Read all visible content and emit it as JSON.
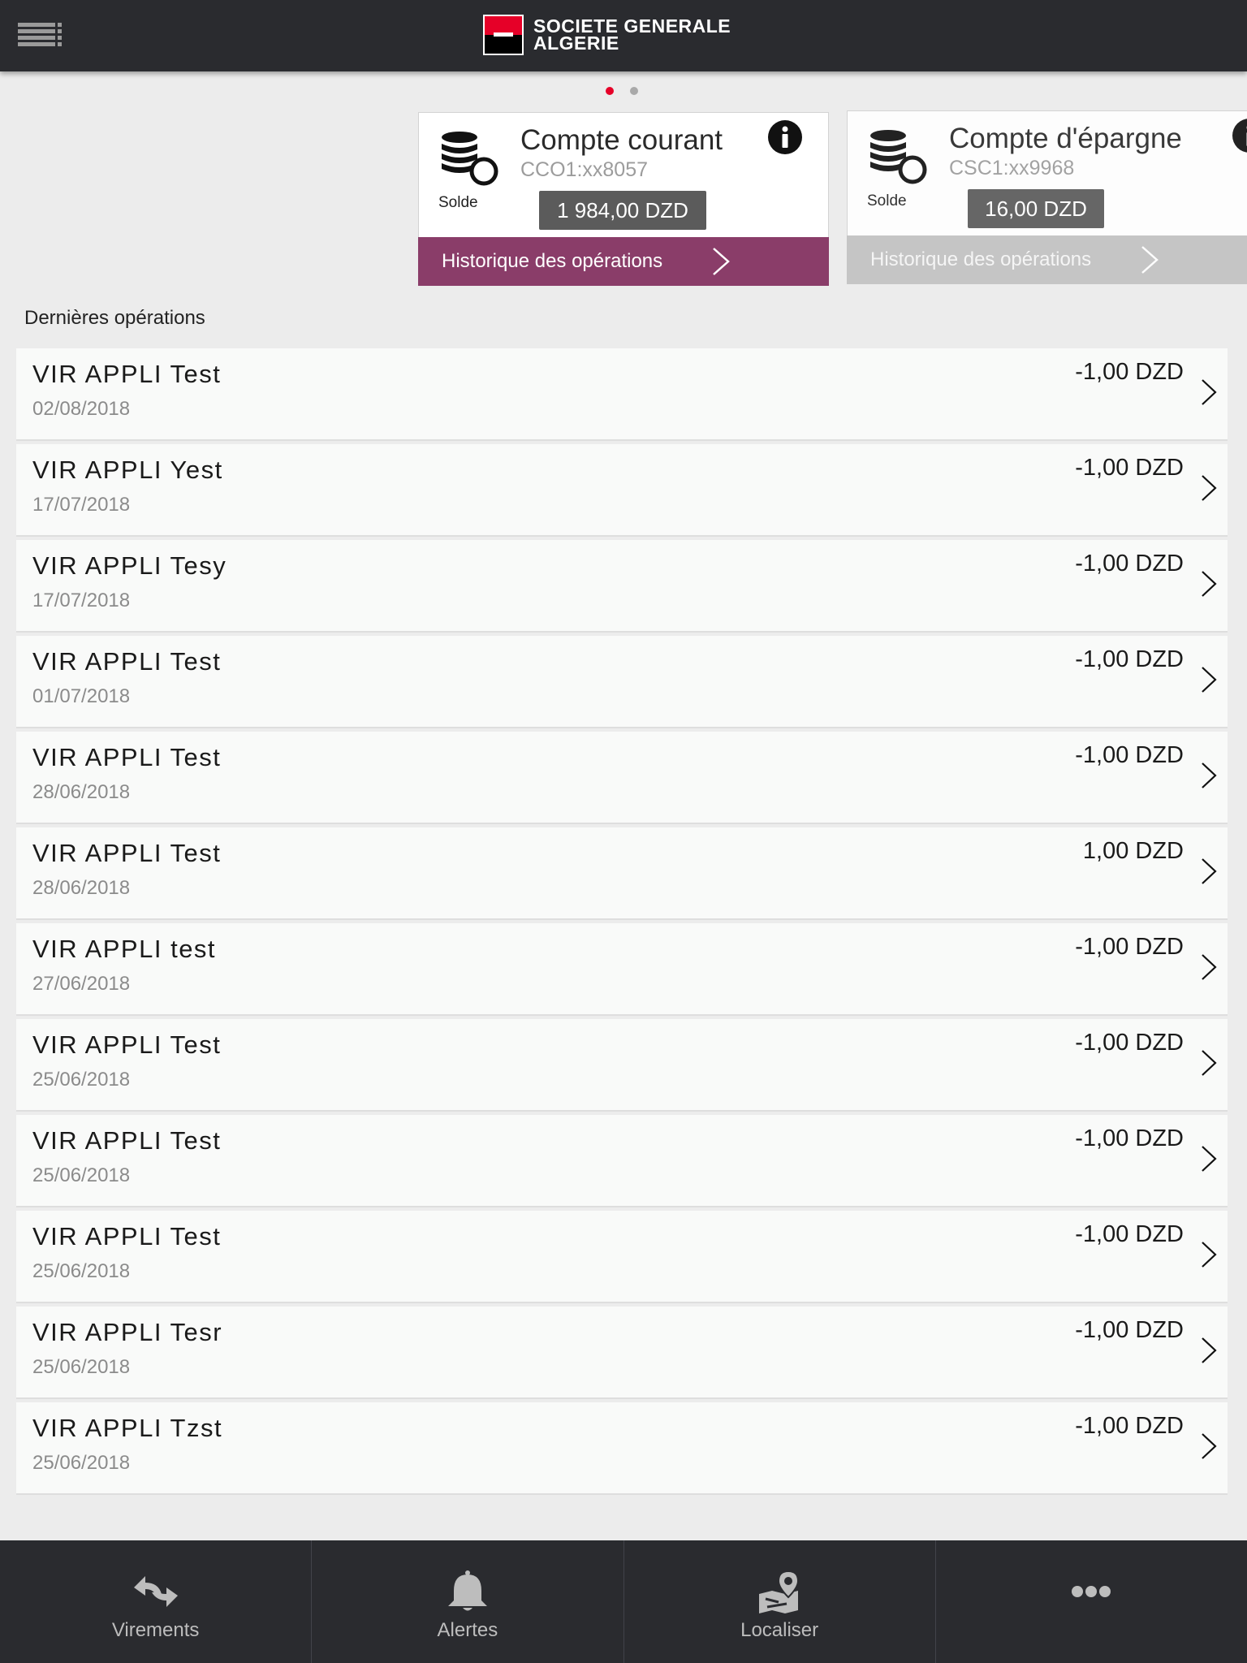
{
  "header": {
    "brand_line1": "SOCIETE GENERALE",
    "brand_line2": "ALGERIE",
    "menu_icon": "hamburger-menu-icon"
  },
  "pager": {
    "pages": 2,
    "active_index": 0
  },
  "accounts": [
    {
      "title": "Compte courant",
      "number": "CCO1:xx8057",
      "solde_label": "Solde",
      "balance": "1 984,00 DZD",
      "history_label": "Historique des opérations"
    },
    {
      "title": "Compte d'épargne",
      "number": "CSC1:xx9968",
      "solde_label": "Solde",
      "balance": "16,00 DZD",
      "history_label": "Historique des opérations"
    }
  ],
  "operations": {
    "title": "Dernières opérations",
    "items": [
      {
        "label": "VIR APPLI Test",
        "date": "02/08/2018",
        "amount": "-1,00 DZD"
      },
      {
        "label": "VIR APPLI Yest",
        "date": "17/07/2018",
        "amount": "-1,00 DZD"
      },
      {
        "label": "VIR APPLI Tesy",
        "date": "17/07/2018",
        "amount": "-1,00 DZD"
      },
      {
        "label": "VIR APPLI Test",
        "date": "01/07/2018",
        "amount": "-1,00 DZD"
      },
      {
        "label": "VIR APPLI Test",
        "date": "28/06/2018",
        "amount": "-1,00 DZD"
      },
      {
        "label": "VIR APPLI Test",
        "date": "28/06/2018",
        "amount": "1,00 DZD"
      },
      {
        "label": "VIR APPLI test",
        "date": "27/06/2018",
        "amount": "-1,00 DZD"
      },
      {
        "label": "VIR APPLI Test",
        "date": "25/06/2018",
        "amount": "-1,00 DZD"
      },
      {
        "label": "VIR APPLI Test",
        "date": "25/06/2018",
        "amount": "-1,00 DZD"
      },
      {
        "label": "VIR APPLI Test",
        "date": "25/06/2018",
        "amount": "-1,00 DZD"
      },
      {
        "label": "VIR APPLI Tesr",
        "date": "25/06/2018",
        "amount": "-1,00 DZD"
      },
      {
        "label": "VIR APPLI Tzst",
        "date": "25/06/2018",
        "amount": "-1,00 DZD"
      }
    ]
  },
  "tabbar": {
    "tabs": [
      {
        "label": "Virements",
        "icon": "transfer-arrows-icon"
      },
      {
        "label": "Alertes",
        "icon": "bell-icon"
      },
      {
        "label": "Localiser",
        "icon": "map-pin-icon"
      },
      {
        "label": "",
        "icon": "more-dots-icon"
      }
    ]
  },
  "colors": {
    "header_bg": "#2a2b2f",
    "brand_red": "#e60028",
    "history_active": "#8a3d69",
    "history_inactive": "#c2c2c2",
    "balance_bg": "#5b5b5b",
    "page_bg": "#ececec"
  }
}
